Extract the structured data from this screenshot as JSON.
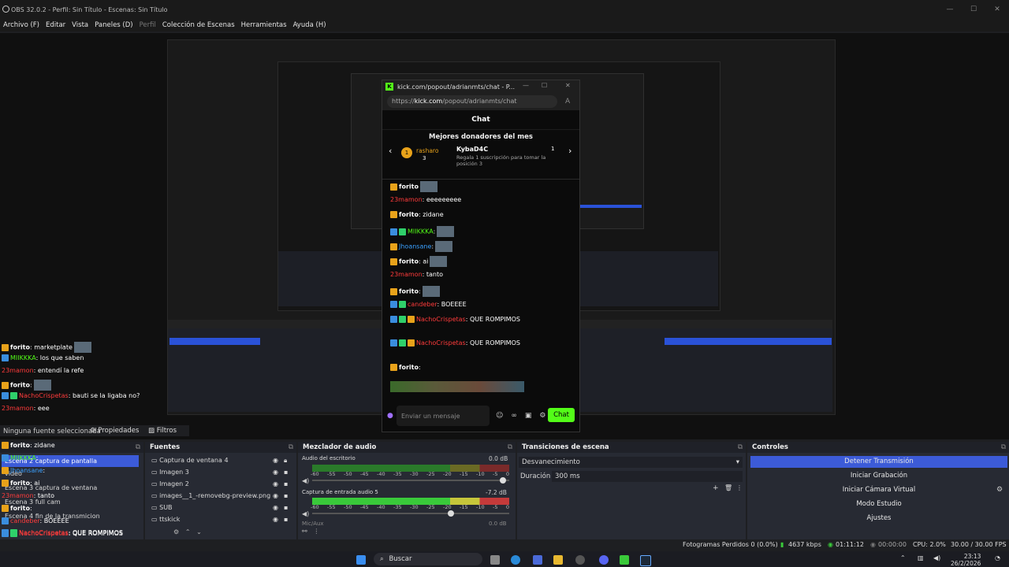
{
  "window": {
    "title": "OBS 32.0.2 - Perfil: Sin Título - Escenas: Sin Título"
  },
  "menu": [
    "Archivo (F)",
    "Editar",
    "Vista",
    "Paneles (D)",
    "Perfil",
    "Colección de Escenas",
    "Herramientas",
    "Ayuda (H)"
  ],
  "chat_window": {
    "title": "kick.com/popout/adrianmts/chat - P...",
    "url_prefix": "https://",
    "url_domain": "kick.com",
    "url_path": "/popout/adrianmts/chat",
    "header": "Chat",
    "donors_title": "Mejores donadores del mes",
    "donor_left": "rasharo",
    "donor_left_count": "3",
    "donor_rank": "1",
    "donor_main": "KybaD4C",
    "donor_main_count": "1",
    "donor_note": "Regala 1 suscripción para tomar la posición 3",
    "messages": [
      {
        "user": "forito",
        "text": ""
      },
      {
        "user": "23mamon",
        "text": ": eeeeeeeee"
      },
      {
        "user": "forito",
        "text": ": zidane"
      },
      {
        "user": "MIIKKKA",
        "text": ":"
      },
      {
        "user": "Jhoansane",
        "text": ":"
      },
      {
        "user": "forito",
        "text": ": ai"
      },
      {
        "user": "23mamon",
        "text": ": tanto"
      },
      {
        "user": "forito",
        "text": ":"
      },
      {
        "user": "candeber",
        "text": ": BOEEEE"
      },
      {
        "user": "NachoCrispetas",
        "text": ": QUE ROMPIMOS"
      },
      {
        "user": "NachoCrispetas",
        "text": ": QUE ROMPIMOS"
      },
      {
        "user": "forito",
        "text": ":"
      }
    ],
    "input_placeholder": "Enviar un mensaje",
    "chat_button": "Chat"
  },
  "left_chat": [
    {
      "user": "forito",
      "text": ": marketplate"
    },
    {
      "user": "MIIKKKA",
      "text": ": los que saben"
    },
    {
      "user": "23mamon",
      "text": ": entendí la refe"
    },
    {
      "user": "forito",
      "text": ":"
    },
    {
      "user": "NachoCrispetas",
      "text": ": bauti se la ligaba no?"
    },
    {
      "user": "23mamon",
      "text": ": eee"
    }
  ],
  "scenes": {
    "items": [
      "Escena 2 captura de pantalla",
      "video",
      "Escena 3 captura de ventana",
      "Escena 3 full cam",
      "Escena 4 fin de la transmicion"
    ],
    "no_source": "Ninguna fuente seleccionada",
    "tabs": [
      "Propiedades",
      "Filtros"
    ],
    "overlay_chat": [
      {
        "user": "forito",
        "text": ": zidane"
      },
      {
        "user": "MIIKKKA",
        "text": ":"
      },
      {
        "user": "Jhoansane",
        "text": ":"
      },
      {
        "user": "forito",
        "text": ": ai"
      },
      {
        "user": "23mamon",
        "text": ": tanto"
      },
      {
        "user": "forito",
        "text": ":"
      },
      {
        "user": "candeber",
        "text": ": BOEEEE"
      },
      {
        "user": "NachoCrispetas",
        "text": ": QUE ROMPIMOS"
      },
      {
        "user": "NachoCrispetas",
        "text": ": QUE ROMPIMOS"
      },
      {
        "user": "forito",
        "text": ":"
      }
    ]
  },
  "sources": {
    "title": "Fuentes",
    "items": [
      "Captura de ventana 4",
      "Imagen 3",
      "Imagen 2",
      "images__1_-removebg-preview.png",
      "SUB",
      "ttskick"
    ]
  },
  "mixer": {
    "title": "Mezclador de audio",
    "channels": [
      {
        "name": "Audio del escritorio",
        "db": "0.0 dB"
      },
      {
        "name": "Captura de entrada audio 5",
        "db": "-7.2 dB"
      }
    ],
    "ticks": [
      "-60",
      "-55",
      "-50",
      "-45",
      "-40",
      "-35",
      "-30",
      "-25",
      "-20",
      "-15",
      "-10",
      "-5",
      "0"
    ],
    "third_channel": "Mic/Aux",
    "third_db": "0.0 dB"
  },
  "transitions": {
    "title": "Transiciones de escena",
    "selected": "Desvanecimiento",
    "duration_label": "Duración",
    "duration_value": "300 ms"
  },
  "controls": {
    "title": "Controles",
    "buttons": [
      "Detener Transmisión",
      "Iniciar Grabación",
      "Iniciar Cámara Virtual",
      "Modo Estudio",
      "Ajustes"
    ]
  },
  "status": {
    "dropped": "Fotogramas Perdidos 0 (0.0%)",
    "bitrate": "4637 kbps",
    "stream_time": "01:11:12",
    "rec_time": "00:00:00",
    "cpu": "CPU: 2.0%",
    "fps": "30.00 / 30.00 FPS"
  },
  "taskbar": {
    "search": "Buscar",
    "time": "23:13",
    "date": "26/2/2026"
  },
  "colors": {
    "accent": "#3c5bd8",
    "kick_green": "#53fc18",
    "username_red": "#ff3b3b",
    "username_blue": "#3aa0ff"
  }
}
